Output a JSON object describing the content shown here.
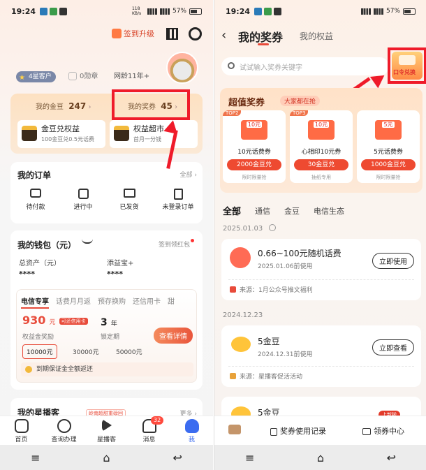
{
  "status": {
    "time": "19:24",
    "net": "118 KB/s",
    "battery": "57%"
  },
  "left": {
    "header": {
      "checkin_label": "签到升级"
    },
    "profile": {
      "tier": "4星客户",
      "medals": "0勋章",
      "network_age": "网龄11年+"
    },
    "assets": {
      "beans_label": "我的金豆",
      "beans_value": "247",
      "rewards_label": "我的奖券",
      "rewards_value": "45",
      "exchange_title": "金豆兑权益",
      "exchange_sub": "100金豆兑0.5元话费",
      "mall_title": "权益超市",
      "mall_sub": "首月一分钱"
    },
    "orders": {
      "title": "我的订单",
      "all": "全部",
      "items": [
        "待付款",
        "进行中",
        "已发货",
        "未登录订单"
      ]
    },
    "wallet": {
      "title": "我的钱包（元）",
      "redpack": "签到领红包",
      "total_label": "总资产（元）",
      "total_value": "****",
      "bao_label": "添益宝+",
      "bao_value": "****",
      "tabs": [
        "电信专享",
        "话费月月返",
        "预存换购",
        "还信用卡",
        "甜"
      ],
      "amount": "930",
      "amount_unit": "元",
      "amount_tag": "可还信用卡",
      "years": "3",
      "years_unit": "年",
      "amount_caption": "权益金奖励",
      "years_caption": "锁定期",
      "detail_button": "查看详情",
      "options": [
        "10000元",
        "30000元",
        "50000元"
      ],
      "notice": "到期保证金全额返还"
    },
    "star": {
      "title": "我的星播客",
      "tag": "岭南超甜重磅回",
      "more": "更多"
    },
    "tabs": [
      {
        "label": "首页",
        "icon": "home-icon"
      },
      {
        "label": "查询办理",
        "icon": "query-icon"
      },
      {
        "label": "星播客",
        "icon": "play-icon"
      },
      {
        "label": "消息",
        "icon": "bell-icon",
        "badge": "32"
      },
      {
        "label": "我",
        "icon": "profile-icon"
      }
    ]
  },
  "right": {
    "title": "我的奖券",
    "tab2": "我的权益",
    "search_placeholder": "试试输入奖券关键字",
    "exchange_badge": "口令兑换",
    "super": {
      "title": "超值奖券",
      "tag": "大家都在抢",
      "items": [
        {
          "top": "TOP2",
          "face": "10元",
          "name": "10元话费券",
          "btn": "2000金豆兑",
          "note": "限时限量抢"
        },
        {
          "top": "TOP3",
          "face": "10元",
          "name": "心相印10元券",
          "btn": "30金豆兑",
          "note": "抽纸专用"
        },
        {
          "top": "",
          "face": "5元",
          "name": "5元话费券",
          "btn": "1000金豆兑",
          "note": "限时限量抢"
        }
      ]
    },
    "filters": [
      "全部",
      "通信",
      "金豆",
      "电信生态"
    ],
    "groups": [
      {
        "date": "2025.01.03",
        "title": "0.66~100元随机话费",
        "expiry": "2025.01.06前使用",
        "button": "立即使用",
        "source": "来源：1月公众号推文福利"
      },
      {
        "date": "2024.12.23",
        "title": "5金豆",
        "expiry": "2024.12.31前使用",
        "button": "立即查看",
        "source": "来源：星播客促活活动"
      }
    ],
    "partial": {
      "title": "5金豆",
      "badge": "上新啦"
    },
    "bottom": {
      "history": "奖券使用记录",
      "center": "领券中心"
    }
  }
}
